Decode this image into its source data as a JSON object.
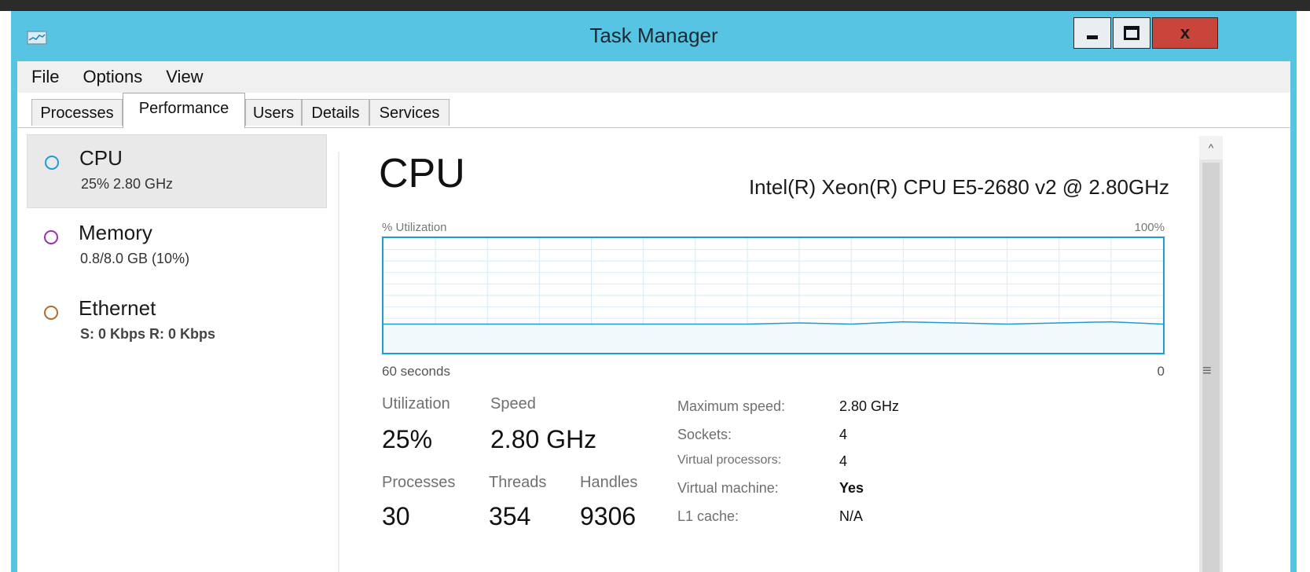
{
  "window": {
    "title": "Task Manager",
    "close_label": "x",
    "accent": "#58c4e4",
    "close_color": "#c9443a",
    "graph_color": "#1e9bd7"
  },
  "menu": [
    "File",
    "Options",
    "View"
  ],
  "tabs": [
    {
      "label": "Processes",
      "active": false
    },
    {
      "label": "Performance",
      "active": true
    },
    {
      "label": "Users",
      "active": false
    },
    {
      "label": "Details",
      "active": false
    },
    {
      "label": "Services",
      "active": false
    }
  ],
  "sidebar": {
    "items": [
      {
        "name": "CPU",
        "detail": "25% 2.80 GHz",
        "color": "#1e9bd7",
        "selected": true
      },
      {
        "name": "Memory",
        "detail": "0.8/8.0 GB (10%)",
        "color": "#9b2fae",
        "selected": false
      },
      {
        "name": "Ethernet",
        "detail": "S: 0 Kbps R: 0 Kbps",
        "color": "#b46a2a",
        "selected": false
      }
    ]
  },
  "main": {
    "title": "CPU",
    "model": "Intel(R) Xeon(R) CPU E5-2680 v2 @ 2.80GHz",
    "graph": {
      "label_left": "% Utilization",
      "label_right": "100%",
      "axis_left": "60 seconds",
      "axis_right": "0"
    },
    "stats": {
      "utilization_label": "Utilization",
      "utilization_value": "25%",
      "speed_label": "Speed",
      "speed_value": "2.80 GHz",
      "processes_label": "Processes",
      "processes_value": "30",
      "threads_label": "Threads",
      "threads_value": "354",
      "handles_label": "Handles",
      "handles_value": "9306"
    },
    "specs": [
      {
        "label": "Maximum speed:",
        "value": "2.80 GHz"
      },
      {
        "label": "Sockets:",
        "value": "4"
      },
      {
        "label": "Virtual processors:",
        "value": "4"
      },
      {
        "label": "Virtual machine:",
        "value": "Yes"
      },
      {
        "label": "L1 cache:",
        "value": "N/A"
      }
    ]
  },
  "chart_data": {
    "type": "line",
    "ylim": [
      0,
      100
    ],
    "xlim": [
      60,
      0
    ],
    "series": [
      {
        "x": [
          60,
          56,
          52,
          48,
          44,
          40,
          36,
          32,
          28,
          24,
          20,
          16,
          12,
          8,
          4,
          0
        ],
        "values": [
          25,
          25,
          25,
          25,
          25,
          25,
          25,
          25,
          26,
          25,
          27,
          26,
          25,
          26,
          27,
          25
        ]
      }
    ]
  }
}
